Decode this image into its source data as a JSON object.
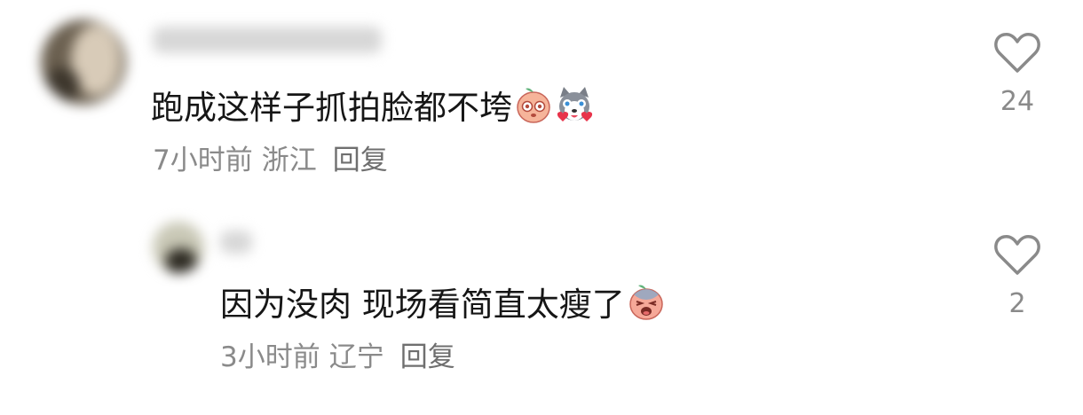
{
  "comments": [
    {
      "username": "shuyyyyy18",
      "text": "跑成这样子抓拍脸都不垮",
      "emojis": [
        "peach-face-staring-emoji",
        "husky-heart-eyes-emoji"
      ],
      "time": "7小时前",
      "location": "浙江",
      "reply_label": "回复",
      "like_count": "24",
      "like_icon": "heart-outline-icon"
    },
    {
      "username": "kk",
      "text": "因为没肉 现场看简直太瘦了",
      "emojis": [
        "peach-face-crying-emoji"
      ],
      "time": "3小时前",
      "location": "辽宁",
      "reply_label": "回复",
      "like_count": "2",
      "like_icon": "heart-outline-icon"
    }
  ],
  "colors": {
    "text": "#161616",
    "meta": "#8a8a8a",
    "icon": "#8a8a8a",
    "background": "#ffffff"
  }
}
